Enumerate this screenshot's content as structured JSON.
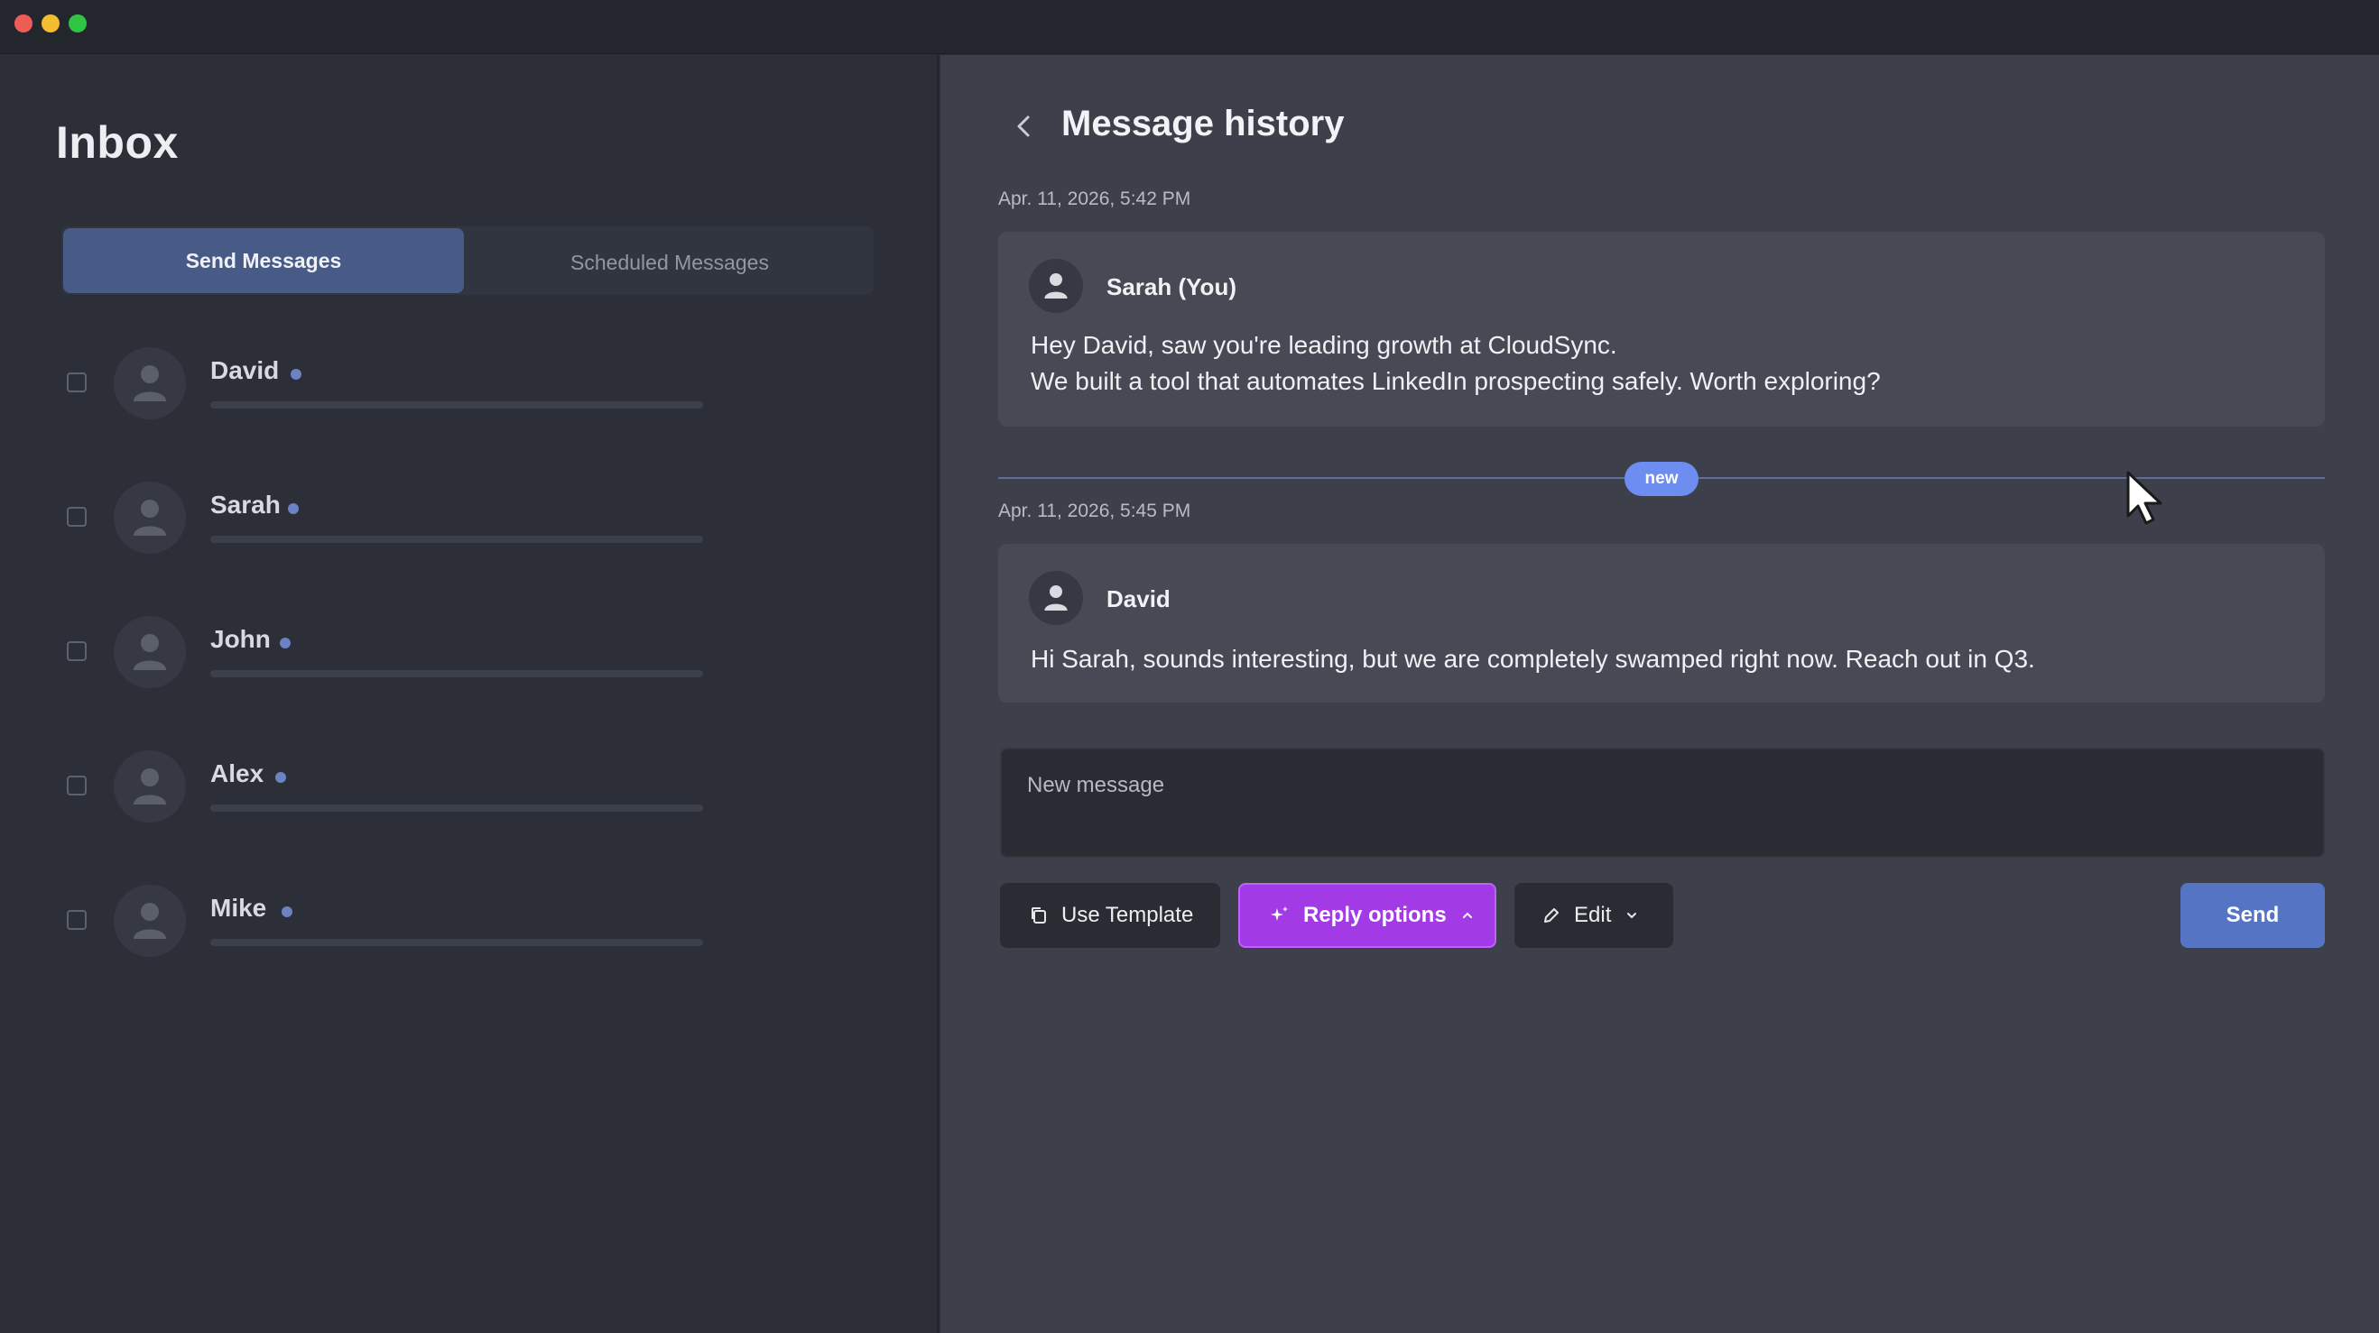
{
  "window": {
    "controls": [
      "close",
      "minimize",
      "maximize"
    ]
  },
  "sidebar": {
    "title": "Inbox",
    "tabs": [
      {
        "label": "Send Messages",
        "active": true
      },
      {
        "label": "Scheduled Messages",
        "active": false
      }
    ],
    "contacts": [
      {
        "name": "David",
        "checked": false,
        "status_color": "#6c82c2"
      },
      {
        "name": "Sarah",
        "checked": false,
        "status_color": "#6c82c2"
      },
      {
        "name": "John",
        "checked": false,
        "status_color": "#6c82c2"
      },
      {
        "name": "Alex",
        "checked": false,
        "status_color": "#6c82c2"
      },
      {
        "name": "Mike",
        "checked": false,
        "status_color": "#6c82c2"
      }
    ]
  },
  "main": {
    "title": "Message history",
    "back_icon": "chevron-left-icon",
    "messages": [
      {
        "timestamp": "Apr. 11, 2026, 5:42 PM",
        "sender": "Sarah (You)",
        "lines": [
          "Hey David, saw you're leading growth at CloudSync.",
          "We built a tool that automates LinkedIn prospecting safely. Worth exploring?"
        ]
      },
      {
        "timestamp": "Apr. 11, 2026, 5:45 PM",
        "sender": "David",
        "lines": [
          "Hi Sarah, sounds interesting, but we are completely swamped right now. Reach out in Q3."
        ]
      }
    ],
    "new_badge": "new",
    "composer": {
      "placeholder": "New message",
      "value": ""
    },
    "actions": {
      "use_template": "Use Template",
      "reply_options": "Reply options",
      "edit": "Edit",
      "send": "Send"
    }
  },
  "colors": {
    "accent_blue": "#5674c4",
    "reply_purple": "#a23be6",
    "new_badge": "#6d8ef0"
  }
}
